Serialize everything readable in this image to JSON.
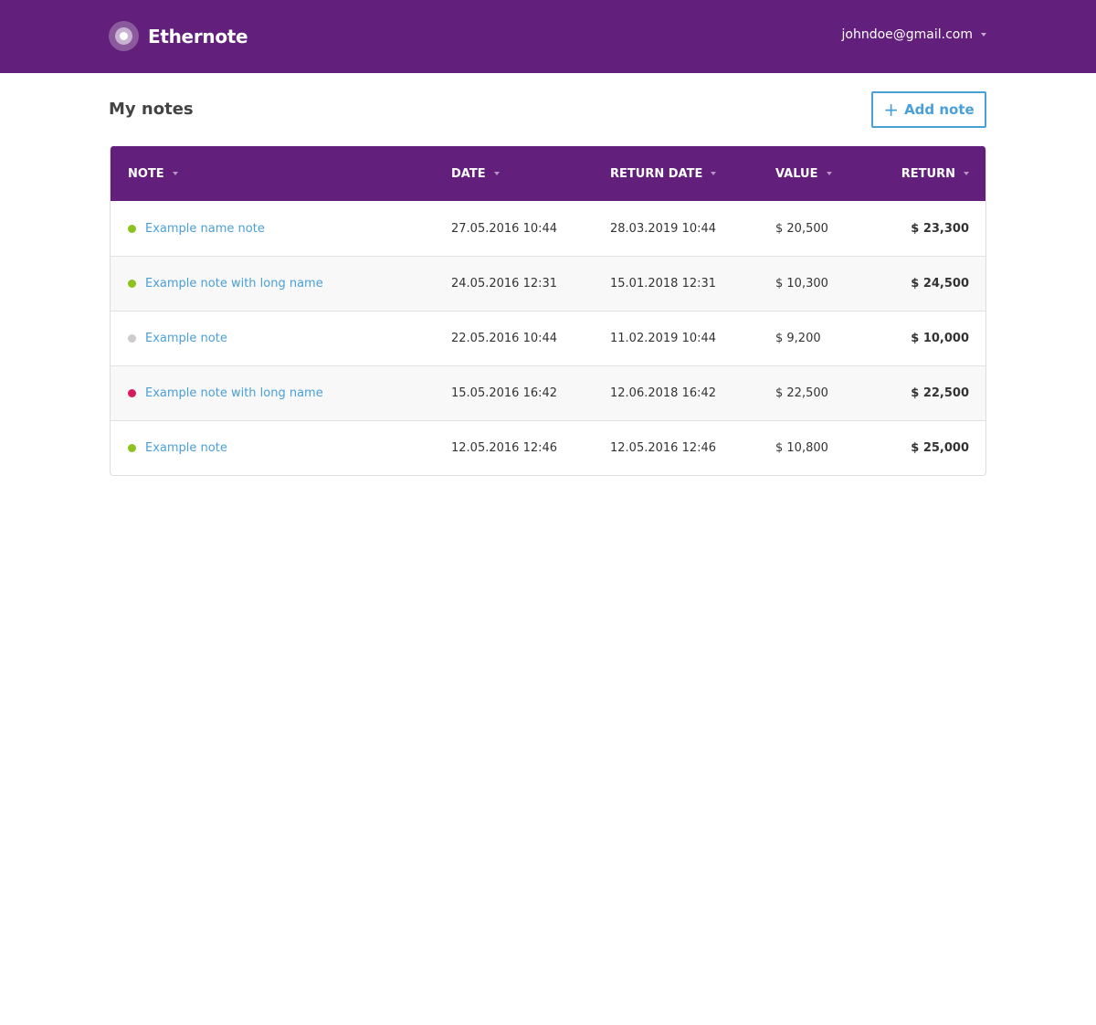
{
  "header": {
    "app_name": "Ethernote",
    "user_email": "johndoe@gmail.com"
  },
  "page": {
    "title": "My notes",
    "add_label": "Add note"
  },
  "table": {
    "columns": [
      "NOTE",
      "DATE",
      "RETURN DATE",
      "VALUE",
      "RETURN"
    ],
    "rows": [
      {
        "status": "green",
        "name": "Example name note",
        "date": "27.05.2016 10:44",
        "return_date": "28.03.2019 10:44",
        "value": "$ 20,500",
        "return": "$ 23,300"
      },
      {
        "status": "green",
        "name": "Example note with long name",
        "date": "24.05.2016 12:31",
        "return_date": "15.01.2018 12:31",
        "value": "$ 10,300",
        "return": "$ 24,500"
      },
      {
        "status": "gray",
        "name": "Example note",
        "date": "22.05.2016 10:44",
        "return_date": "11.02.2019 10:44",
        "value": "$ 9,200",
        "return": "$ 10,000"
      },
      {
        "status": "red",
        "name": "Example note with long name",
        "date": "15.05.2016 16:42",
        "return_date": "12.06.2018 16:42",
        "value": "$ 22,500",
        "return": "$ 22,500"
      },
      {
        "status": "green",
        "name": "Example note",
        "date": "12.05.2016 12:46",
        "return_date": "12.05.2016 12:46",
        "value": "$ 10,800",
        "return": "$ 25,000"
      }
    ]
  },
  "colors": {
    "brand": "#621f7c",
    "link": "#4a9fd8",
    "status_green": "#8dc21f",
    "status_gray": "#cccccc",
    "status_red": "#d81b60"
  }
}
